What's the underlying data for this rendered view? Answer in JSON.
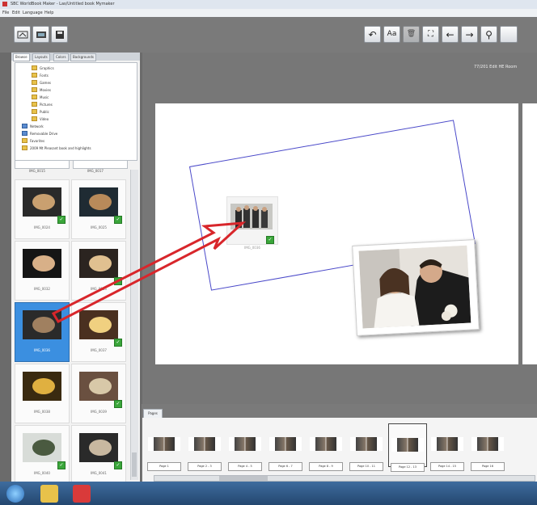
{
  "window": {
    "title": "SBC WorldBook Maker - Las/Untitled book Mymaker"
  },
  "menu": [
    "File",
    "Edit",
    "Language",
    "Help"
  ],
  "toolbar_left": [
    {
      "icon": "open-book-icon"
    },
    {
      "icon": "photos-icon"
    },
    {
      "icon": "save-icon"
    }
  ],
  "toolbar_right": [
    {
      "icon": "undo-icon",
      "glyph": "↶"
    },
    {
      "icon": "text-icon",
      "glyph": "Aa"
    },
    {
      "icon": "delete-icon",
      "glyph": "🗑"
    },
    {
      "icon": "fit-icon",
      "glyph": "⛶"
    },
    {
      "icon": "arrow-left-icon",
      "glyph": "←"
    },
    {
      "icon": "arrow-right-icon",
      "glyph": "→"
    },
    {
      "icon": "zoom-icon",
      "glyph": "⚲"
    }
  ],
  "left_tabs": [
    "Browse",
    "Layouts",
    "Colors",
    "Backgrounds"
  ],
  "folder_tree": [
    {
      "label": "Graphics",
      "indent": 3,
      "type": "folder"
    },
    {
      "label": "Fonts",
      "indent": 3,
      "type": "folder"
    },
    {
      "label": "Games",
      "indent": 3,
      "type": "folder"
    },
    {
      "label": "Movies",
      "indent": 3,
      "type": "folder"
    },
    {
      "label": "Music",
      "indent": 3,
      "type": "folder"
    },
    {
      "label": "Pictures",
      "indent": 3,
      "type": "folder"
    },
    {
      "label": "Public",
      "indent": 3,
      "type": "folder"
    },
    {
      "label": "Video",
      "indent": 3,
      "type": "folder"
    },
    {
      "label": "Network",
      "indent": 1,
      "type": "drive"
    },
    {
      "label": "Removable Drive",
      "indent": 1,
      "type": "drive"
    },
    {
      "label": "Favorites",
      "indent": 1,
      "type": "folder"
    },
    {
      "label": "2009 Mt Pleasant book and highlights",
      "indent": 1,
      "type": "folder"
    }
  ],
  "path_fields": [
    "IMG_0015",
    "IMG_0017"
  ],
  "thumbnails": [
    {
      "caption": "IMG_0024",
      "selected": false,
      "used": true,
      "colors": [
        "#2a2a2a",
        "#c9a070"
      ]
    },
    {
      "caption": "IMG_0025",
      "selected": false,
      "used": true,
      "colors": [
        "#1f2b33",
        "#b88a5a"
      ]
    },
    {
      "caption": "IMG_0032",
      "selected": false,
      "used": false,
      "colors": [
        "#151515",
        "#d8b088"
      ]
    },
    {
      "caption": "IMG_0033",
      "selected": false,
      "used": true,
      "colors": [
        "#2b2420",
        "#e0c090"
      ]
    },
    {
      "caption": "IMG_0036",
      "selected": true,
      "used": false,
      "colors": [
        "#2a2a2a",
        "#a08060"
      ]
    },
    {
      "caption": "IMG_0037",
      "selected": false,
      "used": true,
      "colors": [
        "#4a3020",
        "#f0d080"
      ]
    },
    {
      "caption": "IMG_0038",
      "selected": false,
      "used": false,
      "colors": [
        "#3a2a10",
        "#e0b040"
      ]
    },
    {
      "caption": "IMG_0039",
      "selected": false,
      "used": true,
      "colors": [
        "#6a5040",
        "#d8c8a8"
      ]
    },
    {
      "caption": "IMG_0040",
      "selected": false,
      "used": true,
      "colors": [
        "#d8dcd8",
        "#4a5a40"
      ]
    },
    {
      "caption": "IMG_0041",
      "selected": false,
      "used": true,
      "colors": [
        "#2a2a2a",
        "#c8b8a0"
      ]
    }
  ],
  "page_info": "77/201 Edit HE Room",
  "drop_thumb": {
    "caption": "IMG_0036"
  },
  "pages_tab": "Pages",
  "pages": [
    {
      "label": "Page 1",
      "selected": false
    },
    {
      "label": "Page 2 - 3",
      "selected": false
    },
    {
      "label": "Page 4 - 5",
      "selected": false
    },
    {
      "label": "Page 6 - 7",
      "selected": false
    },
    {
      "label": "Page 8 - 9",
      "selected": false
    },
    {
      "label": "Page 10 - 11",
      "selected": false
    },
    {
      "label": "Page 12 - 13",
      "selected": true
    },
    {
      "label": "Page 14 - 15",
      "selected": false
    },
    {
      "label": "Page 16",
      "selected": false
    }
  ],
  "taskbar": [
    {
      "icon": "start-orb-icon",
      "color": "#4fa3e8"
    },
    {
      "icon": "folder-icon",
      "color": "#e8c24a"
    },
    {
      "icon": "app-icon",
      "color": "#d93a3a"
    }
  ],
  "colors": {
    "accent": "#3b8fe0",
    "arrow": "#d8262b",
    "selection": "#4a49c9"
  }
}
